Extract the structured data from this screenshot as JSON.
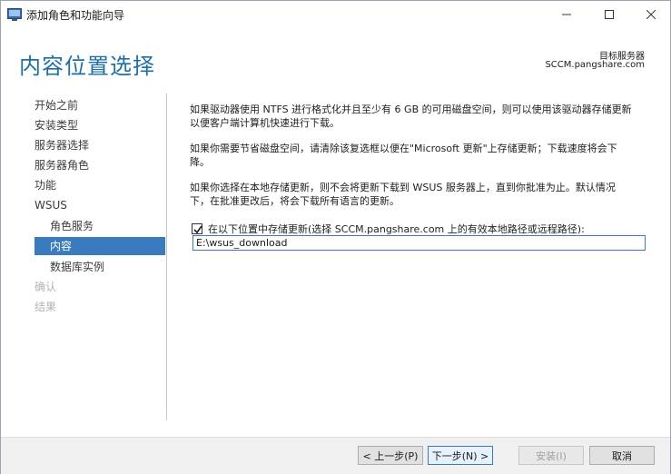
{
  "window": {
    "title": "添加角色和功能向导"
  },
  "header": {
    "page_title": "内容位置选择",
    "target_label": "目标服务器",
    "target_value": "SCCM.pangshare.com"
  },
  "nav": {
    "items": [
      {
        "label": "开始之前",
        "state": "normal"
      },
      {
        "label": "安装类型",
        "state": "normal"
      },
      {
        "label": "服务器选择",
        "state": "normal"
      },
      {
        "label": "服务器角色",
        "state": "normal"
      },
      {
        "label": "功能",
        "state": "normal"
      },
      {
        "label": "WSUS",
        "state": "normal"
      },
      {
        "label": "角色服务",
        "state": "sub"
      },
      {
        "label": "内容",
        "state": "active"
      },
      {
        "label": "数据库实例",
        "state": "sub"
      },
      {
        "label": "确认",
        "state": "disabled"
      },
      {
        "label": "结果",
        "state": "disabled"
      }
    ]
  },
  "content": {
    "para1_line1": "如果驱动器使用 NTFS 进行格式化并且至少有 6 GB 的可用磁盘空间，则可以使用该驱动器存储更新",
    "para1_line2": "以便客户端计算机快速进行下载。",
    "para2_line1": "如果你需要节省磁盘空间，请清除该复选框以便在\"Microsoft 更新\"上存储更新；下载速度将会下",
    "para2_line2": "降。",
    "para3_line1": "如果你选择在本地存储更新，则不会将更新下载到 WSUS 服务器上，直到你批准为止。默认情况",
    "para3_line2": "下，在批准更改后，将会下载所有语言的更新。",
    "checkbox_label": "在以下位置中存储更新(选择 SCCM.pangshare.com 上的有效本地路径或远程路径):",
    "checkbox_checked": true,
    "path_value": "E:\\wsus_download"
  },
  "footer": {
    "prev_label": "< 上一步(P)",
    "next_label": "下一步(N) >",
    "install_label": "安装(I)",
    "cancel_label": "取消"
  },
  "colors": {
    "accent": "#3a7abf",
    "title_blue": "#1e6ea8"
  }
}
